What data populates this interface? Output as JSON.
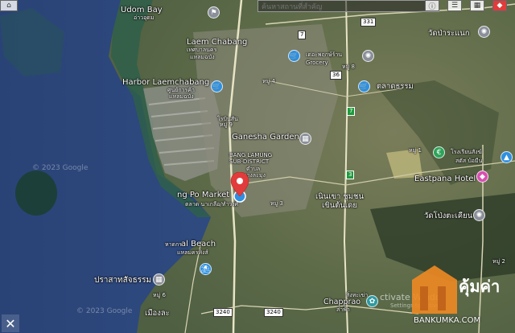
{
  "search": {
    "placeholder": "ค้นหาสถานที่สำคัญ"
  },
  "toolbar": {
    "info_icon": "info-icon",
    "road_icon": "road-icon",
    "grid_icon": "grid-icon",
    "layers_icon": "layers-icon"
  },
  "watermark": {
    "google_top": "© 2023 Google",
    "google_bottom": "© 2023 Google",
    "windows": "ctivate Windo",
    "windows_sub": "Settings to activate"
  },
  "places": {
    "udom_bay": "Udom Bay",
    "udom_bay_th": "อ่าวอุดม",
    "laem_chabang": "Laem Chabang",
    "laem_chabang_th1": "เทศบาลนคร",
    "laem_chabang_th2": "แหลมฉบัง",
    "harbor": "Harbor Laemchabang",
    "harbor_th1": "ศูนย์การค้า",
    "harbor_th2": "แหลมฉบัง",
    "robinson": "โรบินสัน",
    "ganesha": "Ganesha Garden",
    "bang_lamung_1": "BANG LAMUNG",
    "bang_lamung_2": "SUB-DISTRICT",
    "bang_lamung_th1": "ตำบล",
    "bang_lamung_th2": "บางละมุง",
    "market": "ng Po Market",
    "market_th": "ตลาด นาเกลือ/ทำวงศ์",
    "beach": "al Beach",
    "beach_th1": "หาดกร",
    "beach_th2": "แหลมครหิงส์",
    "prasat": "ปราสาทสัจธรรม",
    "grocery": "Grocery",
    "grocery_th": "เดอะพฤกษ์ร้าน",
    "market2": "ตลาดธรรม",
    "wat1": "วัดป่าระแนก",
    "eastpana": "Eastpana Hotel",
    "wat2": "วัดโป่งตะเคียน",
    "hotel_th1": "โรงเรียนสังฆ์",
    "hotel_th2": "สตัส บ้อมีน",
    "noen": "เนินเขา ชุมชน",
    "noen2": "เขินต้นเดย",
    "chapprao": "Chapprao",
    "chapprao_th": "ส่าพ้า",
    "chappray_sub": "สิ่งทะเข่า",
    "mueang": "เมืองละ",
    "village1": "หมู่ 9",
    "village2": "หมู่ 1",
    "village3": "หมู่ 3",
    "village4": "หมู่ 6",
    "village5": "หมู่ 4",
    "village6": "หมู่ 2",
    "village7": "หมู่ 8"
  },
  "roads": {
    "r331": "331",
    "r7": "7",
    "r3240": "3240",
    "r3240b": "3240",
    "r36": "36",
    "r7b": "7",
    "r3": "3"
  },
  "logo": {
    "word": "คุ้มค่า",
    "domain": "BANKUMKA.COM"
  },
  "colors": {
    "sea": "#2e4a7a",
    "land": "#6b7256",
    "pin": "#e23b3b",
    "logo_orange": "#ef8a24"
  }
}
